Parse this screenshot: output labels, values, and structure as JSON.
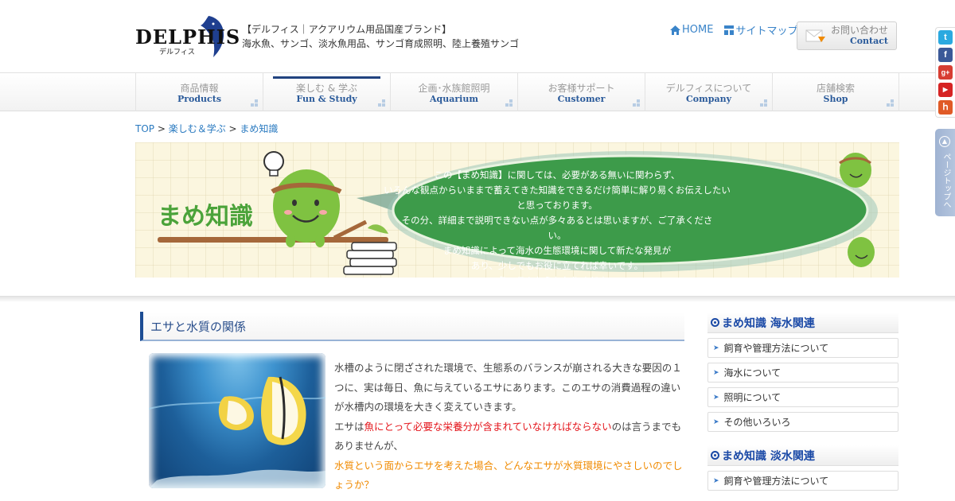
{
  "header": {
    "logo_text": "DELPHIS",
    "logo_sub": "デルフィス",
    "tagline_1": "【デルフィス｜アクアリウム用品国産ブランド】",
    "tagline_2": "海水魚、サンゴ、淡水魚用品、サンゴ育成照明、陸上養殖サンゴ",
    "home_link": "HOME",
    "sitemap_link": "サイトマップ",
    "contact_jp": "お問い合わせ",
    "contact_en": "Contact"
  },
  "nav": [
    {
      "jp": "商品情報",
      "en": "Products",
      "active": false
    },
    {
      "jp": "楽しむ & 学ぶ",
      "en": "Fun & Study",
      "active": true
    },
    {
      "jp": "企画･水族館照明",
      "en": "Aquarium",
      "active": false
    },
    {
      "jp": "お客様サポート",
      "en": "Customer",
      "active": false
    },
    {
      "jp": "デルフィスについて",
      "en": "Company",
      "active": false
    },
    {
      "jp": "店舗検索",
      "en": "Shop",
      "active": false
    }
  ],
  "breadcrumb": {
    "top": "TOP",
    "sep": " > ",
    "parent": "楽しむ＆学ぶ",
    "current": "まめ知識"
  },
  "banner": {
    "title": "まめ知識",
    "lines": [
      "この【まめ知識】に関しては、必要がある無いに関わらず、",
      "いろんな観点からいままで蓄えてきた知識をできるだけ簡単に解り易くお伝えしたいと思っております。",
      "その分、詳細まで説明できない点が多々あるとは思いますが、ご了承ください。",
      "まめ知識によって海水の生態環境に関して新たな発見が",
      "あり、少しでもお役に立てれば幸いです。",
      "…各コラムからお入りください。"
    ]
  },
  "article": {
    "heading": "エサと水質の関係",
    "p1": "水槽のように閉ざされた環境で、生態系のバランスが崩される大きな要因の１つに、実は毎日、魚に与えているエサにあります。このエサの消費過程の違いが水槽内の環境を大きく変えていきます。",
    "p2_pre": "エサは",
    "p2_red": "魚にとって必要な栄養分が含まれていなければならない",
    "p2_post": "のは言うまでもありませんが、",
    "p3": "水質という面からエサを考えた場合、どんなエサが水質環境にやさしいのでしょうか？"
  },
  "sidebar": {
    "sections": [
      {
        "title": "まめ知識 海水関連",
        "items": [
          "飼育や管理方法について",
          "海水について",
          "照明について",
          "その他いろいろ"
        ]
      },
      {
        "title": "まめ知識 淡水関連",
        "items": [
          "飼育や管理方法について"
        ]
      }
    ]
  },
  "floating": {
    "social": [
      {
        "icon": "twitter-icon",
        "glyph": "t",
        "color": "#2aa9e0"
      },
      {
        "icon": "facebook-icon",
        "glyph": "f",
        "color": "#3b5998"
      },
      {
        "icon": "google-plus-icon",
        "glyph": "g+",
        "color": "#d73d32"
      },
      {
        "icon": "youtube-icon",
        "glyph": "▶",
        "color": "#d62424"
      },
      {
        "icon": "hatena-icon",
        "glyph": "ｈ",
        "color": "#e05a26"
      }
    ],
    "pagetop": "ページトップへ"
  },
  "colors": {
    "accent": "#1d4d94",
    "link": "#2a7ac0",
    "banner_green": "#4ba33a",
    "highlight_red": "#e4161c",
    "highlight_orange": "#f08a00"
  }
}
